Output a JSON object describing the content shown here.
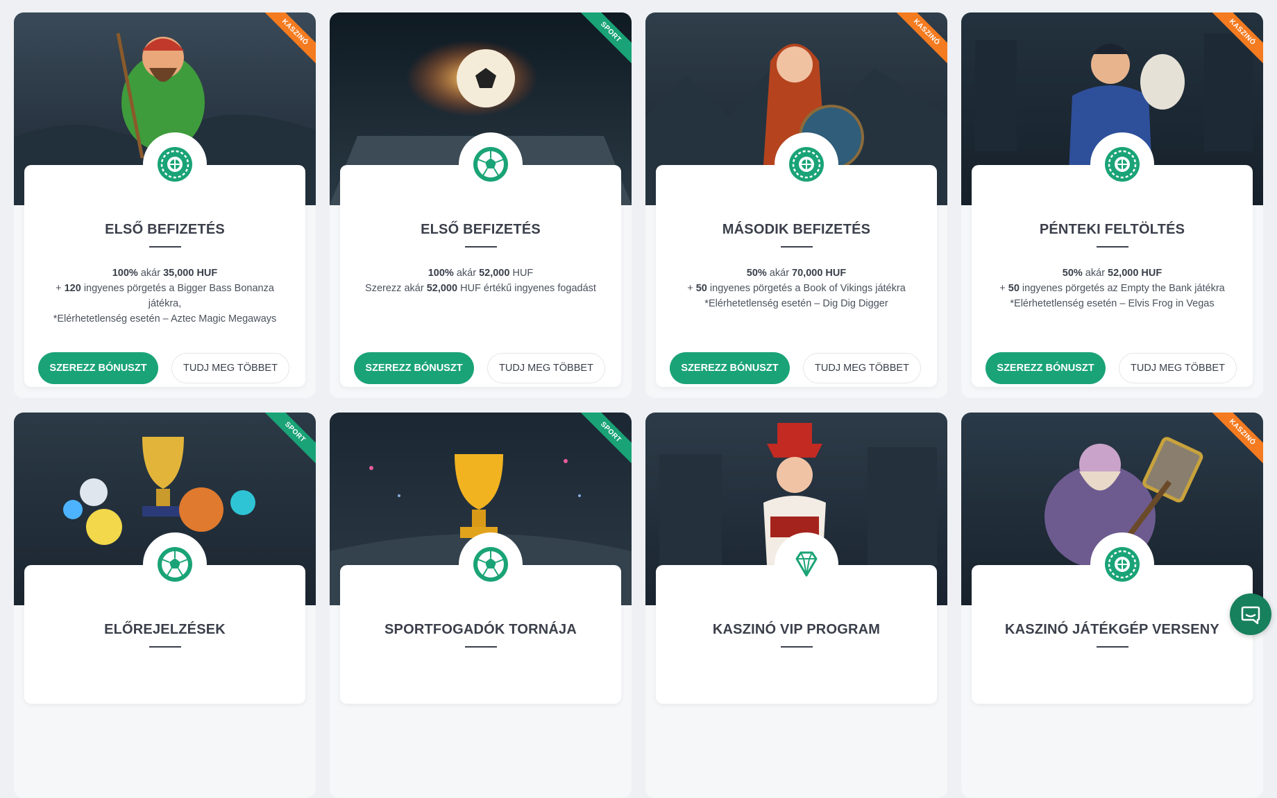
{
  "cards": [
    {
      "ribbon": "KASZINÓ",
      "ribbon_type": "casino",
      "icon": "roulette-icon",
      "title": "ELSŐ BEFIZETÉS",
      "line1": {
        "a": "100%",
        "b": " akár ",
        "c": "35,000 HUF",
        "d": ""
      },
      "line2": {
        "a": "+ ",
        "b": "120",
        "c": " ingyenes pörgetés a Bigger Bass Bonanza"
      },
      "line3": "játékra,",
      "line4": "*Elérhetetlenség esetén – Aztec Magic Megaways",
      "cta": "SZEREZZ BÓNUSZT",
      "more": "TUDJ MEG TÖBBET"
    },
    {
      "ribbon": "SPORT",
      "ribbon_type": "sport",
      "icon": "football-icon",
      "title": "ELSŐ BEFIZETÉS",
      "line1": {
        "a": "100%",
        "b": " akár ",
        "c": "52,000",
        "d": " HUF"
      },
      "line2": {
        "a": "Szerezz akár ",
        "b": "52,000",
        "c": " HUF értékű ingyenes fogadást"
      },
      "line3": "",
      "line4": "",
      "cta": "SZEREZZ BÓNUSZT",
      "more": "TUDJ MEG TÖBBET"
    },
    {
      "ribbon": "KASZINÓ",
      "ribbon_type": "casino",
      "icon": "roulette-icon",
      "title": "MÁSODIK BEFIZETÉS",
      "line1": {
        "a": "50%",
        "b": " akár ",
        "c": "70,000 HUF",
        "d": ""
      },
      "line2": {
        "a": "+ ",
        "b": "50",
        "c": " ingyenes pörgetés a Book of Vikings játékra"
      },
      "line3": "*Elérhetetlenség esetén – Dig Dig Digger",
      "line4": "",
      "cta": "SZEREZZ BÓNUSZT",
      "more": "TUDJ MEG TÖBBET"
    },
    {
      "ribbon": "KASZINÓ",
      "ribbon_type": "casino",
      "icon": "roulette-icon",
      "title": "PÉNTEKI FELTÖLTÉS",
      "line1": {
        "a": "50%",
        "b": " akár ",
        "c": "52,000 HUF",
        "d": ""
      },
      "line2": {
        "a": "+ ",
        "b": "50",
        "c": " ingyenes pörgetés az Empty the Bank játékra"
      },
      "line3": "*Elérhetetlenség esetén – Elvis Frog in Vegas",
      "line4": "",
      "cta": "SZEREZZ BÓNUSZT",
      "more": "TUDJ MEG TÖBBET"
    },
    {
      "ribbon": "SPORT",
      "ribbon_type": "sport",
      "icon": "football-icon",
      "title": "ELŐREJELZÉSEK"
    },
    {
      "ribbon": "SPORT",
      "ribbon_type": "sport",
      "icon": "football-icon",
      "title": "SPORTFOGADÓK TORNÁJA"
    },
    {
      "ribbon": "",
      "ribbon_type": "none",
      "icon": "diamond-icon",
      "title": "KASZINÓ VIP PROGRAM"
    },
    {
      "ribbon": "KASZINÓ",
      "ribbon_type": "casino",
      "icon": "roulette-icon",
      "title": "KASZINÓ JÁTÉKGÉP VERSENY"
    }
  ],
  "colors": {
    "accent": "#1aa376",
    "casino_ribbon": "#f47b20",
    "sport_ribbon": "#1aa376",
    "chat": "#17805d"
  },
  "chat_icon": "chat-icon"
}
